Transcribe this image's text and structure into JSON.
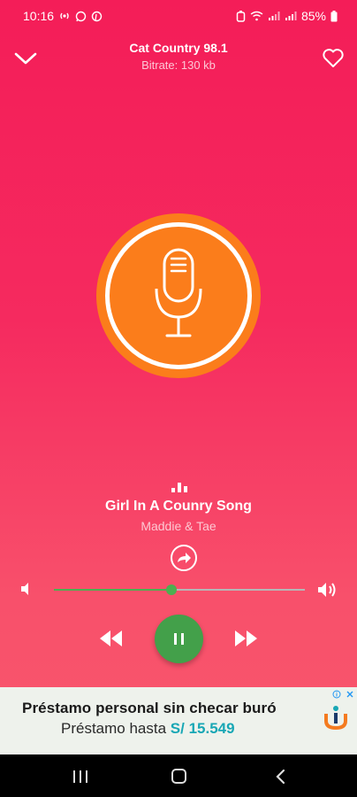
{
  "status_bar": {
    "time": "10:16",
    "battery": "85%",
    "left_icons": [
      "broadcast-icon",
      "whatsapp-icon",
      "pinterest-icon"
    ],
    "right_icons": [
      "alarm-icon",
      "wifi-icon",
      "signal-icon",
      "signal-icon",
      "battery-icon"
    ]
  },
  "header": {
    "station_name": "Cat Country 98.1",
    "bitrate": "Bitrate: 130 kb"
  },
  "now_playing": {
    "title": "Girl In A Counry Song",
    "artist": "Maddie & Tae"
  },
  "volume": {
    "level": 0.47
  },
  "ad": {
    "headline": "Préstamo personal sin checar buró",
    "sub_text": "Préstamo hasta",
    "amount": "S/ 15.549"
  },
  "colors": {
    "background_top": "#f41d58",
    "background_bottom": "#f9586c",
    "artwork_orange": "#fb7d1b",
    "accent_green": "#43a04a",
    "ad_teal": "#18a7b5"
  }
}
